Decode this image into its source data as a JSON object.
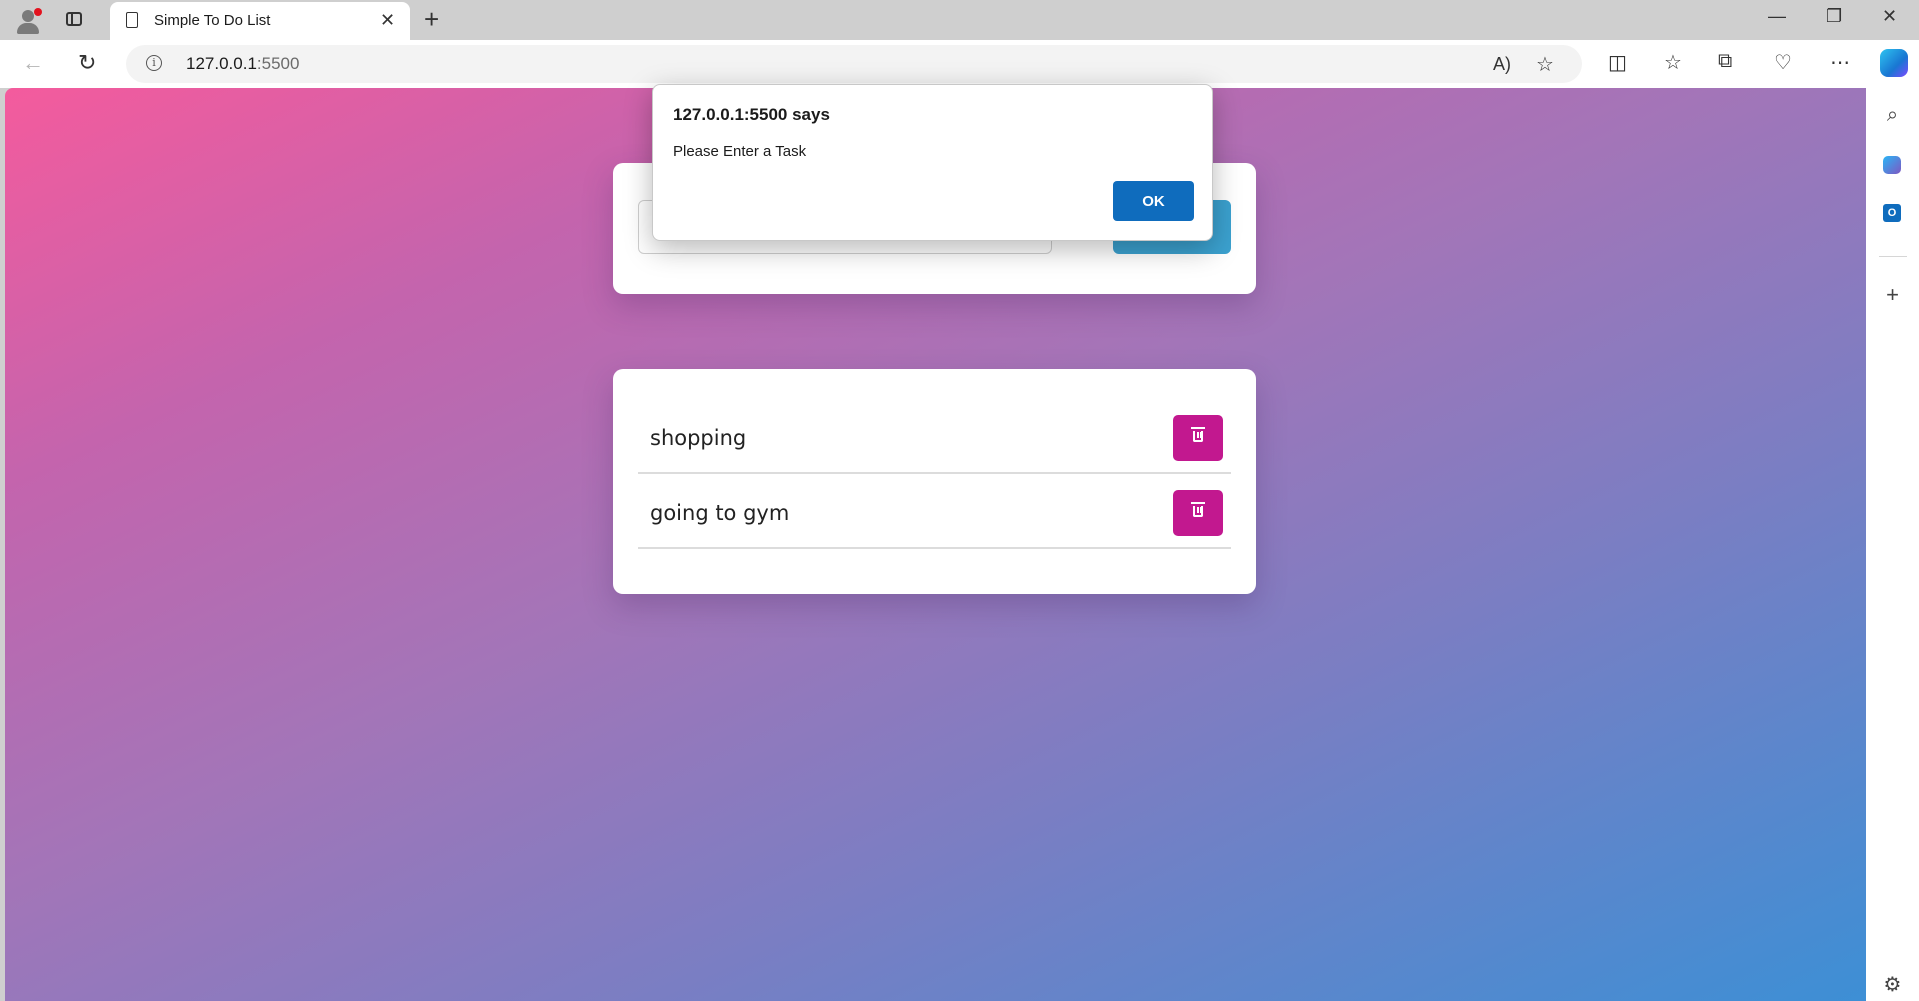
{
  "browser": {
    "tab_title": "Simple To Do List",
    "url_host": "127.0.0.1",
    "url_port": ":5500",
    "tab_close": "✕",
    "new_tab": "+",
    "window_controls": [
      "—",
      "❐",
      "✕"
    ],
    "read_aloud_label": "A)"
  },
  "todo": {
    "input_value": "",
    "add_button_label": "",
    "tasks": [
      {
        "label": "shopping"
      },
      {
        "label": "going to gym"
      }
    ]
  },
  "alert": {
    "title": "127.0.0.1:5500 says",
    "message": "Please Enter a Task",
    "ok_label": "OK"
  },
  "colors": {
    "accent_add": "#3ba1cf",
    "accent_delete": "#c2188f",
    "dialog_button": "#0f6cbd",
    "gradient_start": "#f45b9d",
    "gradient_end": "#3d8fd5"
  },
  "icons": {
    "profile": "profile-icon",
    "tab_actions": "tab-actions-icon",
    "back": "back-arrow-icon",
    "refresh": "refresh-icon",
    "info": "info-icon",
    "read_aloud": "read-aloud-icon",
    "favorite": "star-icon",
    "split_screen": "split-screen-icon",
    "favorites": "favorites-icon",
    "collections": "collections-icon",
    "browser_essentials": "heart-pulse-icon",
    "more": "more-icon",
    "copilot": "copilot-icon",
    "search": "search-icon",
    "outlook": "outlook-icon",
    "add": "plus-icon",
    "settings": "gear-icon",
    "delete": "trash-icon"
  }
}
